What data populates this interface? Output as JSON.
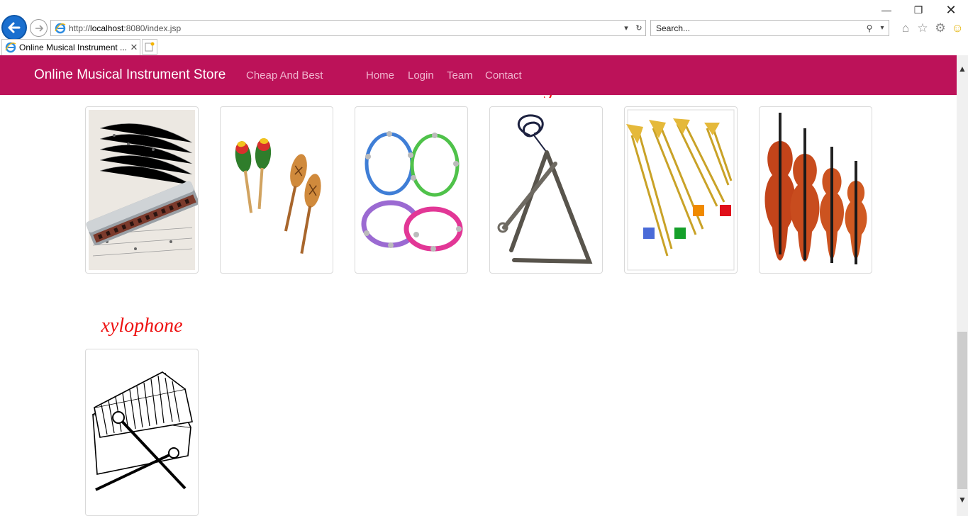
{
  "browser": {
    "url_prefix": "http://",
    "url_host": "localhost",
    "url_rest": ":8080/index.jsp",
    "search_placeholder": "Search...",
    "tab_title": "Online Musical Instrument ...",
    "window_controls": [
      "minimize",
      "restore",
      "close"
    ],
    "toolbar_icons": [
      "home-icon",
      "favorites-star-icon",
      "settings-gear-icon",
      "smiley-feedback-icon"
    ]
  },
  "navbar": {
    "brand": "Online Musical Instrument Store",
    "tagline": "Cheap And Best",
    "links": [
      "Home",
      "Login",
      "Team",
      "Contact"
    ],
    "background": "#bc1259"
  },
  "products": {
    "row1": [
      "harmonica",
      "maracas",
      "tambourine",
      "triangle",
      "trombone",
      "violin"
    ],
    "row2": [
      {
        "title": "xylophone",
        "image": "xylophone"
      }
    ],
    "title_color": "#e01111"
  }
}
